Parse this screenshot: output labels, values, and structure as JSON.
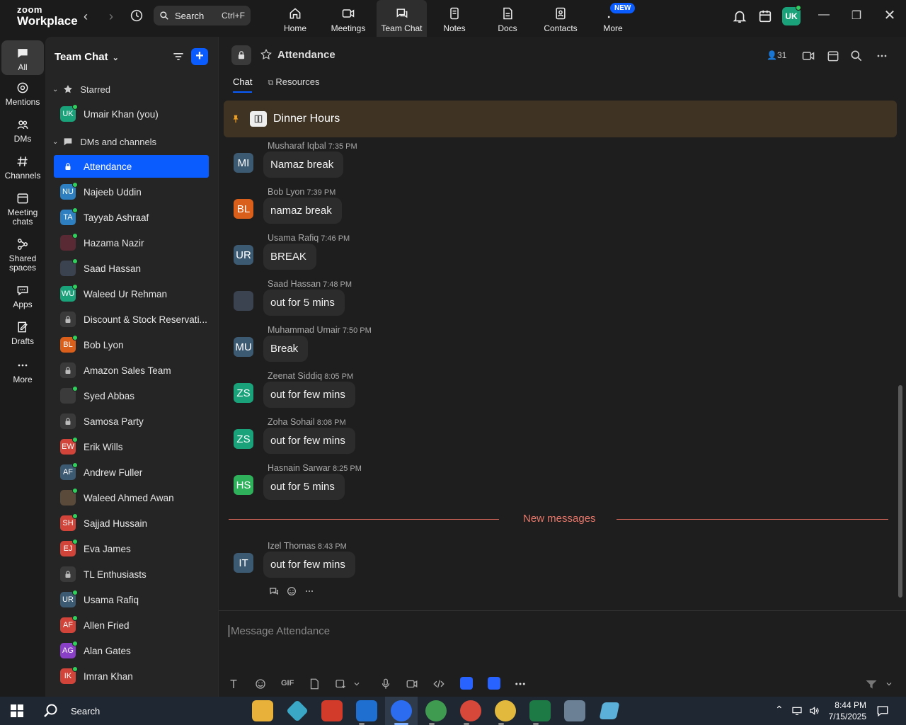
{
  "app": {
    "logo_top": "zoom",
    "logo_bottom": "Workplace",
    "search_label": "Search",
    "search_shortcut": "Ctrl+F",
    "tabs": [
      {
        "label": "Home"
      },
      {
        "label": "Meetings"
      },
      {
        "label": "Team Chat"
      },
      {
        "label": "Notes"
      },
      {
        "label": "Docs"
      },
      {
        "label": "Contacts"
      },
      {
        "label": "More"
      }
    ],
    "new_badge": "NEW",
    "user_initials": "UK"
  },
  "rail": {
    "items": [
      {
        "label": "All"
      },
      {
        "label": "Mentions"
      },
      {
        "label": "DMs"
      },
      {
        "label": "Channels"
      },
      {
        "label": "Meeting chats"
      },
      {
        "label": "Shared spaces"
      },
      {
        "label": "Apps"
      },
      {
        "label": "Drafts"
      },
      {
        "label": "More"
      }
    ]
  },
  "sidebar": {
    "title": "Team Chat",
    "starred_label": "Starred",
    "dms_label": "DMs and channels",
    "starred": [
      {
        "initials": "UK",
        "name": "Umair Khan (you)",
        "color": "#1aa37a"
      }
    ],
    "items": [
      {
        "initials": "",
        "name": "Attendance",
        "lock": true
      },
      {
        "initials": "NU",
        "name": "Najeeb Uddin",
        "color": "#2d7fbf"
      },
      {
        "initials": "TA",
        "name": "Tayyab Ashraaf",
        "color": "#2d7fbf"
      },
      {
        "initials": "",
        "name": "Hazama Nazir",
        "color": "#5a2a34"
      },
      {
        "initials": "",
        "name": "Saad Hassan",
        "color": "#3b4250"
      },
      {
        "initials": "WU",
        "name": "Waleed Ur Rehman",
        "color": "#1aa37a"
      },
      {
        "initials": "",
        "name": "Discount & Stock Reservati...",
        "lock": true
      },
      {
        "initials": "BL",
        "name": "Bob Lyon",
        "color": "#d95f1a"
      },
      {
        "initials": "",
        "name": "Amazon Sales Team",
        "lock": true
      },
      {
        "initials": "",
        "name": "Syed Abbas",
        "color": "#3b3b3b"
      },
      {
        "initials": "",
        "name": "Samosa Party",
        "lock": true
      },
      {
        "initials": "EW",
        "name": "Erik Wills",
        "color": "#d0443a"
      },
      {
        "initials": "AF",
        "name": "Andrew Fuller",
        "color": "#3d5a73"
      },
      {
        "initials": "",
        "name": "Waleed Ahmed Awan",
        "color": "#5a4a3a"
      },
      {
        "initials": "SH",
        "name": "Sajjad Hussain",
        "color": "#d0443a"
      },
      {
        "initials": "EJ",
        "name": "Eva James",
        "color": "#d0443a"
      },
      {
        "initials": "",
        "name": "TL Enthusiasts",
        "lock": true
      },
      {
        "initials": "UR",
        "name": "Usama Rafiq",
        "color": "#3d5a73"
      },
      {
        "initials": "AF",
        "name": "Allen Fried",
        "color": "#d0443a"
      },
      {
        "initials": "AG",
        "name": "Alan Gates",
        "color": "#8a3fc7"
      },
      {
        "initials": "IK",
        "name": "Imran Khan",
        "color": "#d0443a"
      }
    ]
  },
  "channel": {
    "title": "Attendance",
    "member_count": "31",
    "subtabs": [
      "Chat",
      "Resources"
    ],
    "pinned_text": "Dinner Hours",
    "new_messages_label": "New messages",
    "composer_placeholder": "Message Attendance",
    "gif_label": "GIF",
    "messages": [
      {
        "initials": "MI",
        "color": "#3d5a73",
        "name": "Musharaf Iqbal",
        "time": "7:35 PM",
        "text": "Namaz break"
      },
      {
        "initials": "BL",
        "color": "#d95f1a",
        "name": "Bob Lyon",
        "time": "7:39 PM",
        "text": "namaz break"
      },
      {
        "initials": "UR",
        "color": "#3d5a73",
        "name": "Usama Rafiq",
        "time": "7:46 PM",
        "text": "BREAK"
      },
      {
        "initials": "",
        "color": "#3b4250",
        "name": "Saad Hassan",
        "time": "7:48 PM",
        "text": "out for 5 mins"
      },
      {
        "initials": "MU",
        "color": "#3d5a73",
        "name": "Muhammad Umair",
        "time": "7:50 PM",
        "text": "Break"
      },
      {
        "initials": "ZS",
        "color": "#1aa37a",
        "name": "Zeenat Siddiq",
        "time": "8:05 PM",
        "text": "out for few mins"
      },
      {
        "initials": "ZS",
        "color": "#1aa37a",
        "name": "Zoha Sohail",
        "time": "8:08 PM",
        "text": "out for few mins"
      },
      {
        "initials": "HS",
        "color": "#2fb05b",
        "name": "Hasnain Sarwar",
        "time": "8:25 PM",
        "text": "out for 5 mins"
      },
      {
        "initials": "IT",
        "color": "#3d5a73",
        "name": "Izel Thomas",
        "time": "8:43 PM",
        "text": "out for few mins"
      }
    ]
  },
  "taskbar": {
    "search_label": "Search",
    "time": "8:44 PM",
    "date": "7/15/2025"
  }
}
